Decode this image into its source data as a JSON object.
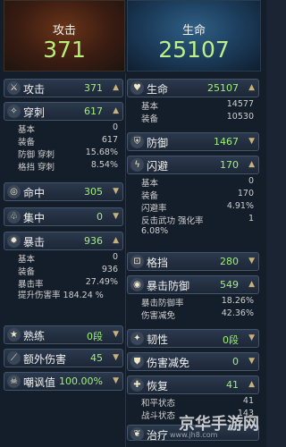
{
  "header": {
    "left": {
      "title": "攻击",
      "value": "371"
    },
    "right": {
      "title": "生命",
      "value": "25107"
    }
  },
  "left": {
    "attack": {
      "label": "攻击",
      "value": "371",
      "icon": "swords-icon"
    },
    "pierce": {
      "label": "穿刺",
      "value": "617",
      "icon": "pierce-icon",
      "rows": [
        {
          "k": "基本",
          "v": "0"
        },
        {
          "k": "装备",
          "v": "617"
        },
        {
          "k": "防御 穿刺",
          "v": "15.68%"
        },
        {
          "k": "格挡 穿刺",
          "v": "8.54%"
        }
      ]
    },
    "hit": {
      "label": "命中",
      "value": "305",
      "icon": "target-icon"
    },
    "focus": {
      "label": "集中",
      "value": "0",
      "icon": "triad-icon"
    },
    "crit": {
      "label": "暴击",
      "value": "936",
      "icon": "burst-icon",
      "rows": [
        {
          "k": "基本",
          "v": "0"
        },
        {
          "k": "装备",
          "v": "936"
        },
        {
          "k": "暴击率",
          "v": "27.49%"
        }
      ],
      "extra": "提升伤害率 184.24 %"
    },
    "proficiency": {
      "label": "熟练",
      "value": "0段",
      "icon": "star-icon"
    },
    "extra_damage": {
      "label": "额外伤害",
      "value": "45",
      "icon": "slash-icon"
    },
    "mock": {
      "label": "嘲讽值",
      "value": "100.00%",
      "icon": "skull-icon"
    }
  },
  "right": {
    "hp": {
      "label": "生命",
      "value": "25107",
      "icon": "heart-icon",
      "rows": [
        {
          "k": "基本",
          "v": "14577"
        },
        {
          "k": "装备",
          "v": "10530"
        }
      ]
    },
    "defense": {
      "label": "防御",
      "value": "1467",
      "icon": "shield-icon"
    },
    "evade": {
      "label": "闪避",
      "value": "170",
      "icon": "lightning-icon",
      "rows": [
        {
          "k": "基本",
          "v": "0"
        },
        {
          "k": "装备",
          "v": "170"
        },
        {
          "k": "闪避率",
          "v": "4.91%"
        },
        {
          "k": "反击武功 强化率",
          "v": "1"
        }
      ],
      "extra": "6.08%"
    },
    "block": {
      "label": "格挡",
      "value": "280",
      "icon": "block-icon"
    },
    "crit_def": {
      "label": "暴击防御",
      "value": "549",
      "icon": "ring-shield-icon",
      "rows": [
        {
          "k": "暴击防御率",
          "v": "18.26%"
        },
        {
          "k": "伤害减免",
          "v": "42.36%"
        }
      ]
    },
    "toughness": {
      "label": "韧性",
      "value": "0段",
      "icon": "flame-icon"
    },
    "dmg_reduce": {
      "label": "伤害减免",
      "value": "0",
      "icon": "guard-icon"
    },
    "recover": {
      "label": "恢复",
      "value": "41",
      "icon": "cross-icon",
      "rows": [
        {
          "k": "和平状态",
          "v": "41"
        },
        {
          "k": "战斗状态",
          "v": "143"
        }
      ]
    },
    "heal": {
      "label": "治疗",
      "value": ""
    }
  },
  "watermark": {
    "text": "京华手游网",
    "sub": "www.jh8.com"
  }
}
